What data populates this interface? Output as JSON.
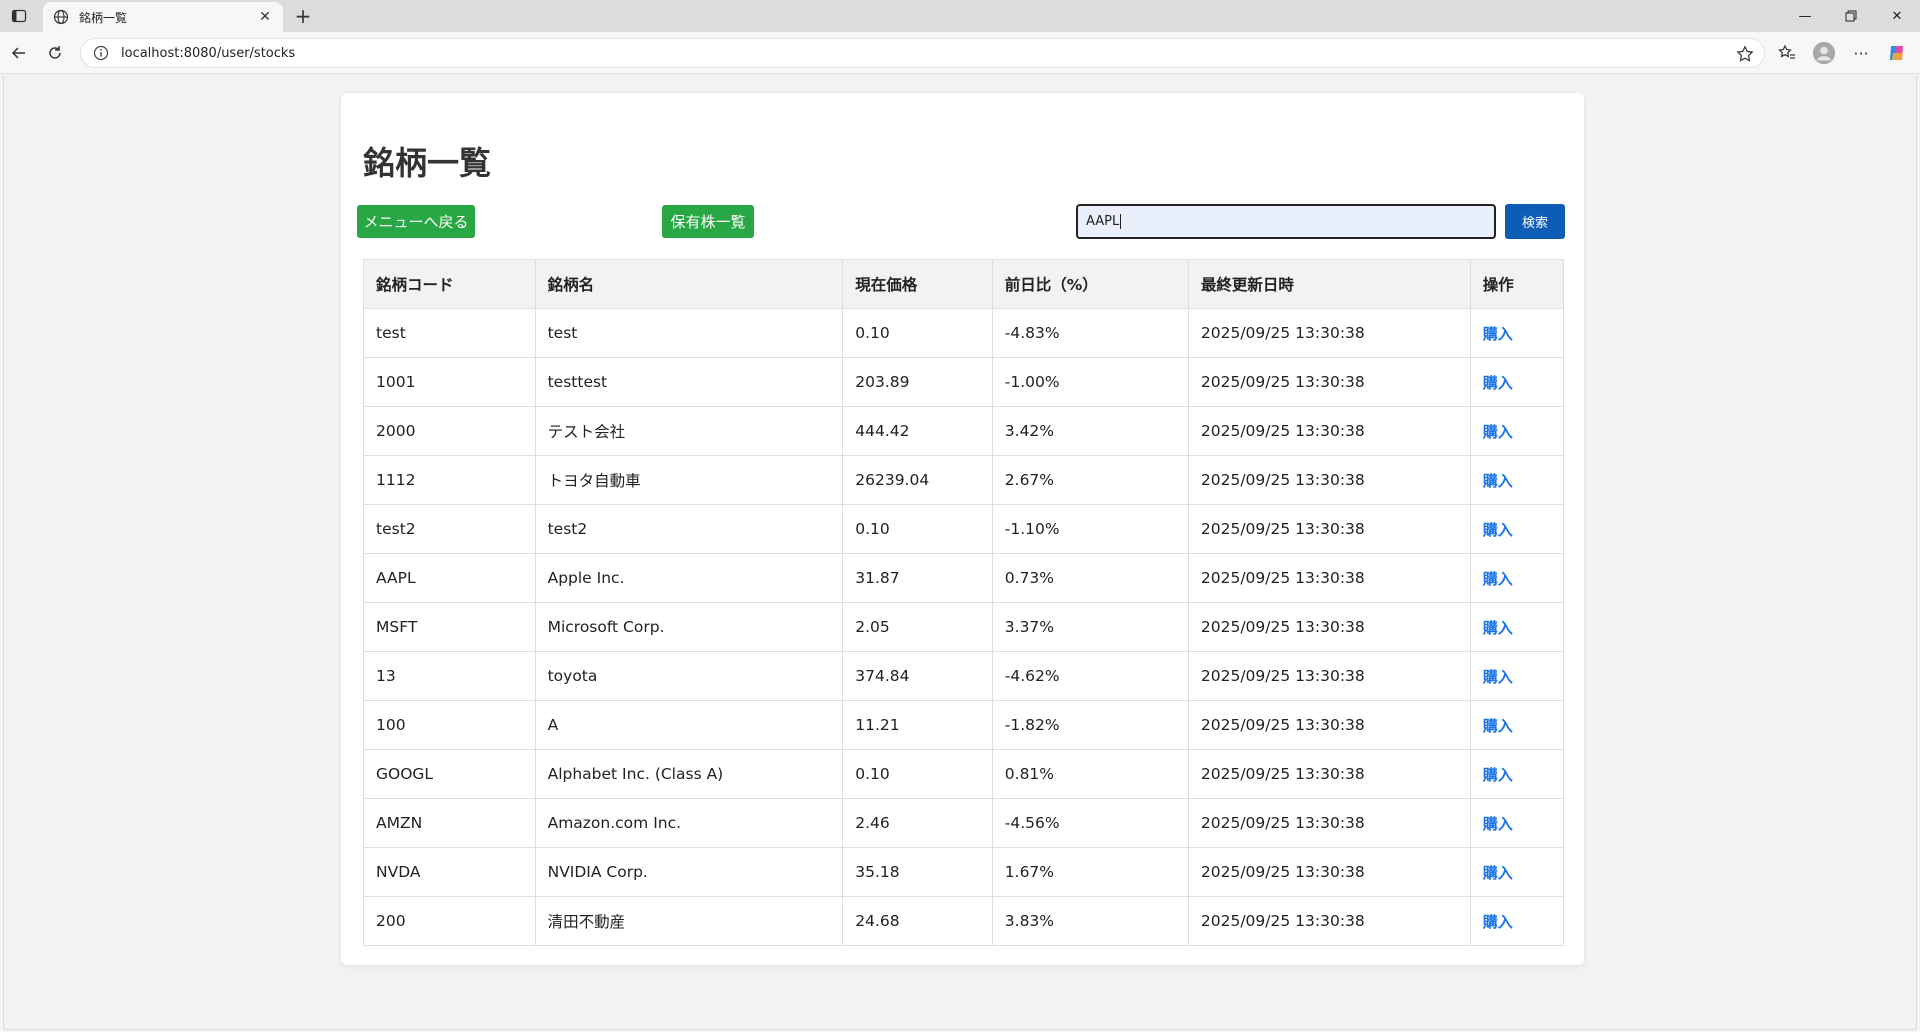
{
  "browser": {
    "tab_title": "銘柄一覧",
    "url": "localhost:8080/user/stocks"
  },
  "page": {
    "title": "銘柄一覧",
    "back_to_menu_label": "メニューへ戻る",
    "holdings_label": "保有株一覧",
    "search_value": "AAPL",
    "search_button_label": "検索"
  },
  "table": {
    "headers": [
      "銘柄コード",
      "銘柄名",
      "現在価格",
      "前日比（%）",
      "最終更新日時",
      "操作"
    ],
    "rows": [
      {
        "code": "test",
        "name": "test",
        "price": "0.10",
        "change": "-4.83%",
        "updated": "2025/09/25 13:30:38",
        "action": "購入"
      },
      {
        "code": "1001",
        "name": "testtest",
        "price": "203.89",
        "change": "-1.00%",
        "updated": "2025/09/25 13:30:38",
        "action": "購入"
      },
      {
        "code": "2000",
        "name": "テスト会社",
        "price": "444.42",
        "change": "3.42%",
        "updated": "2025/09/25 13:30:38",
        "action": "購入"
      },
      {
        "code": "1112",
        "name": "トヨタ自動車",
        "price": "26239.04",
        "change": "2.67%",
        "updated": "2025/09/25 13:30:38",
        "action": "購入"
      },
      {
        "code": "test2",
        "name": "test2",
        "price": "0.10",
        "change": "-1.10%",
        "updated": "2025/09/25 13:30:38",
        "action": "購入"
      },
      {
        "code": "AAPL",
        "name": "Apple Inc.",
        "price": "31.87",
        "change": "0.73%",
        "updated": "2025/09/25 13:30:38",
        "action": "購入"
      },
      {
        "code": "MSFT",
        "name": "Microsoft Corp.",
        "price": "2.05",
        "change": "3.37%",
        "updated": "2025/09/25 13:30:38",
        "action": "購入"
      },
      {
        "code": "13",
        "name": "toyota",
        "price": "374.84",
        "change": "-4.62%",
        "updated": "2025/09/25 13:30:38",
        "action": "購入"
      },
      {
        "code": "100",
        "name": "A",
        "price": "11.21",
        "change": "-1.82%",
        "updated": "2025/09/25 13:30:38",
        "action": "購入"
      },
      {
        "code": "GOOGL",
        "name": "Alphabet Inc. (Class A)",
        "price": "0.10",
        "change": "0.81%",
        "updated": "2025/09/25 13:30:38",
        "action": "購入"
      },
      {
        "code": "AMZN",
        "name": "Amazon.com Inc.",
        "price": "2.46",
        "change": "-4.56%",
        "updated": "2025/09/25 13:30:38",
        "action": "購入"
      },
      {
        "code": "NVDA",
        "name": "NVIDIA Corp.",
        "price": "35.18",
        "change": "1.67%",
        "updated": "2025/09/25 13:30:38",
        "action": "購入"
      },
      {
        "code": "200",
        "name": "清田不動産",
        "price": "24.68",
        "change": "3.83%",
        "updated": "2025/09/25 13:30:38",
        "action": "購入"
      }
    ]
  },
  "colors": {
    "green_button": "#28a745",
    "search_button": "#0d5cb6",
    "link": "#1a73e8"
  }
}
